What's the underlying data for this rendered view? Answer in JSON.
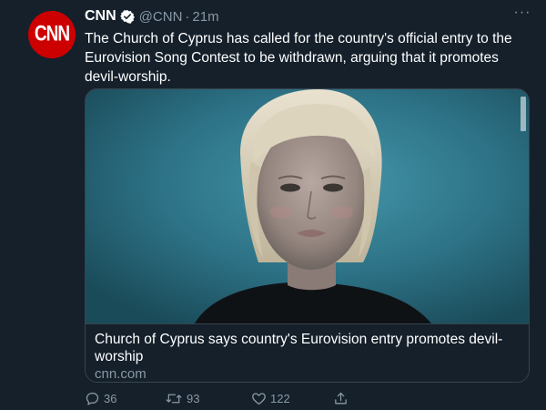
{
  "tweet": {
    "avatar_text": "CNN",
    "author_name": "CNN",
    "handle": "@CNN",
    "separator": "·",
    "time": "21m",
    "more": "···",
    "text": "The Church of Cyprus has called for the country's official entry to the Eurovision Song Contest to be withdrawn, arguing that it promotes devil-worship."
  },
  "card": {
    "title": "Church of Cyprus says country's Eurovision entry promotes devil-worship",
    "domain": "cnn.com"
  },
  "actions": {
    "replies": "36",
    "retweets": "93",
    "likes": "122"
  },
  "colors": {
    "background": "#15202b",
    "secondary_text": "#8899a6",
    "border": "#38444d",
    "verified": "#ffffff",
    "brand": "#cc0000"
  }
}
